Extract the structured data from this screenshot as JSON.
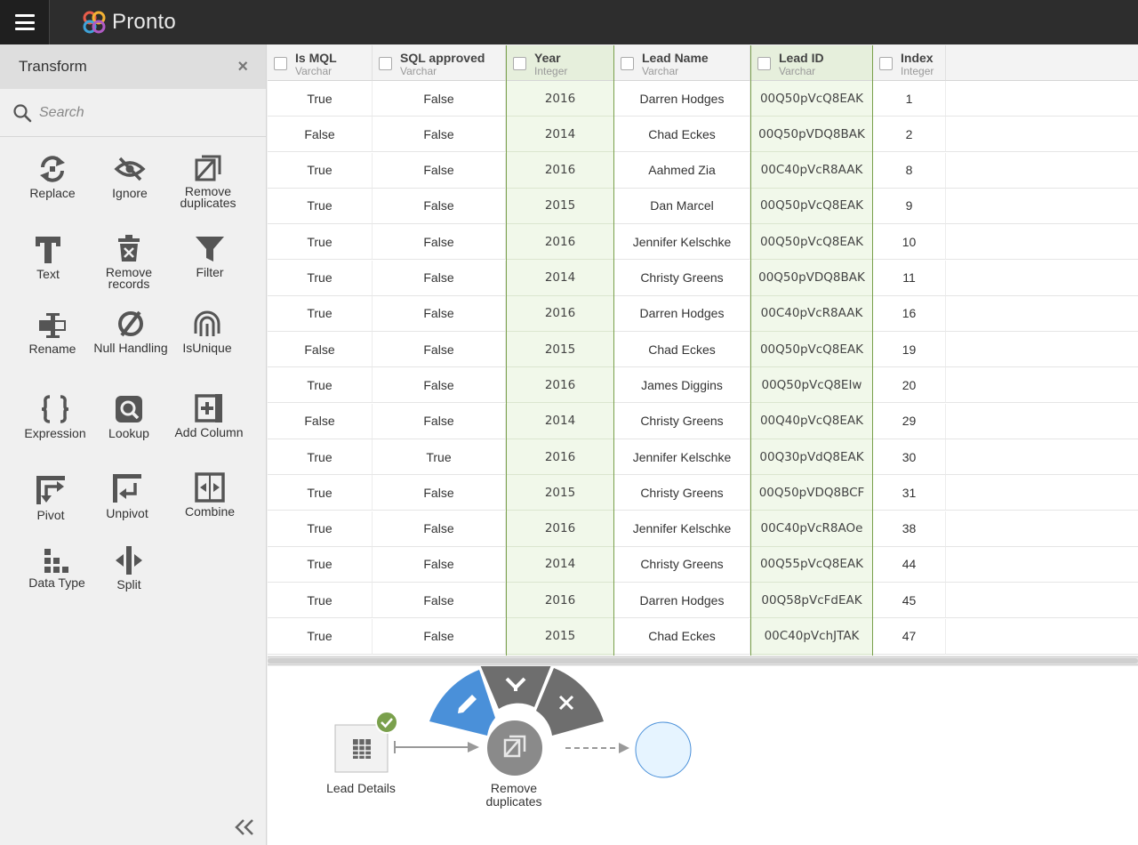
{
  "app": {
    "name": "Pronto"
  },
  "sidebar": {
    "title": "Transform",
    "close_glyph": "×",
    "search_placeholder": "Search",
    "tools": [
      {
        "label": "Replace",
        "icon": "replace-icon"
      },
      {
        "label": "Ignore",
        "icon": "eye-slash-icon"
      },
      {
        "label": "Remove duplicates",
        "icon": "remove-duplicates-icon"
      },
      {
        "label": "Text",
        "icon": "text-icon"
      },
      {
        "label": "Remove records",
        "icon": "remove-records-icon"
      },
      {
        "label": "Filter",
        "icon": "filter-icon"
      },
      {
        "label": "Rename",
        "icon": "rename-icon"
      },
      {
        "label": "Null Handling",
        "icon": "null-icon"
      },
      {
        "label": "IsUnique",
        "icon": "fingerprint-icon"
      },
      {
        "label": "Expression",
        "icon": "braces-icon"
      },
      {
        "label": "Lookup",
        "icon": "lookup-icon"
      },
      {
        "label": "Add Column",
        "icon": "add-column-icon"
      },
      {
        "label": "Pivot",
        "icon": "pivot-icon"
      },
      {
        "label": "Unpivot",
        "icon": "unpivot-icon"
      },
      {
        "label": "Combine",
        "icon": "combine-icon"
      },
      {
        "label": "Data Type",
        "icon": "data-type-icon"
      },
      {
        "label": "Split",
        "icon": "split-icon"
      }
    ]
  },
  "grid": {
    "columns": [
      {
        "name": "Is MQL",
        "type": "Varchar",
        "selected": false
      },
      {
        "name": "SQL approved",
        "type": "Varchar",
        "selected": false
      },
      {
        "name": "Year",
        "type": "Integer",
        "selected": true
      },
      {
        "name": "Lead Name",
        "type": "Varchar",
        "selected": false
      },
      {
        "name": "Lead ID",
        "type": "Varchar",
        "selected": true
      },
      {
        "name": "Index",
        "type": "Integer",
        "selected": false
      }
    ],
    "rows": [
      [
        "True",
        "False",
        "2016",
        "Darren Hodges",
        "00Q50pVcQ8EAK",
        "1"
      ],
      [
        "False",
        "False",
        "2014",
        "Chad Eckes",
        "00Q50pVDQ8BAK",
        "2"
      ],
      [
        "True",
        "False",
        "2016",
        "Aahmed Zia",
        "00C40pVcR8AAK",
        "8"
      ],
      [
        "True",
        "False",
        "2015",
        "Dan Marcel",
        "00Q50pVcQ8EAK",
        "9"
      ],
      [
        "True",
        "False",
        "2016",
        "Jennifer Kelschke",
        "00Q50pVcQ8EAK",
        "10"
      ],
      [
        "True",
        "False",
        "2014",
        "Christy Greens",
        "00Q50pVDQ8BAK",
        "11"
      ],
      [
        "True",
        "False",
        "2016",
        "Darren Hodges",
        "00C40pVcR8AAK",
        "16"
      ],
      [
        "False",
        "False",
        "2015",
        "Chad Eckes",
        "00Q50pVcQ8EAK",
        "19"
      ],
      [
        "True",
        "False",
        "2016",
        "James Diggins",
        "00Q50pVcQ8EIw",
        "20"
      ],
      [
        "False",
        "False",
        "2014",
        "Christy Greens",
        "00Q40pVcQ8EAK",
        "29"
      ],
      [
        "True",
        "True",
        "2016",
        "Jennifer Kelschke",
        "00Q30pVdQ8EAK",
        "30"
      ],
      [
        "True",
        "False",
        "2015",
        "Christy Greens",
        "00Q50pVDQ8BCF",
        "31"
      ],
      [
        "True",
        "False",
        "2016",
        "Jennifer Kelschke",
        "00C40pVcR8AOe",
        "38"
      ],
      [
        "True",
        "False",
        "2014",
        "Christy Greens",
        "00Q55pVcQ8EAK",
        "44"
      ],
      [
        "True",
        "False",
        "2016",
        "Darren Hodges",
        "00Q58pVcFdEAK",
        "45"
      ],
      [
        "True",
        "False",
        "2015",
        "Chad Eckes",
        "00C40pVchJTAK",
        "47"
      ]
    ]
  },
  "flow": {
    "source_node": {
      "label": "Lead Details",
      "icon": "table-icon",
      "status": "check-icon"
    },
    "transform_node": {
      "label_line1": "Remove",
      "label_line2": "duplicates",
      "icon": "remove-duplicates-icon"
    },
    "radial_menu": [
      {
        "name": "edit",
        "icon": "pencil-icon",
        "active": true
      },
      {
        "name": "expand",
        "icon": "chevron-down-icon",
        "active": false
      },
      {
        "name": "delete",
        "icon": "close-icon",
        "active": false
      }
    ],
    "target_node": {
      "label": ""
    }
  },
  "colors": {
    "topbar": "#2d2d2d",
    "selected_col_bg": "#f1f8ea",
    "selected_col_border": "#7aa04c",
    "accent_blue": "#4a90d9",
    "menu_gray": "#6e6e6e",
    "success_green": "#7aa04c",
    "target_node": "#e6f4ff"
  }
}
